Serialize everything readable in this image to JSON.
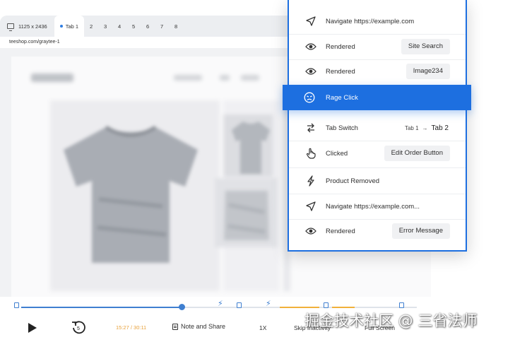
{
  "tabbar": {
    "dimensions": "1125 x 2436",
    "tabs": [
      "Tab 1",
      "2",
      "3",
      "4",
      "5",
      "6",
      "7",
      "8"
    ]
  },
  "url": "teeshop.com/graytee-1",
  "controls": {
    "time": "15:27 / 30:11",
    "note_label": "Note and Share",
    "speed_label": "1X",
    "skip_label": "Skip Inactivity",
    "fullscreen_label": "Full Screen"
  },
  "events": {
    "navigate1": "Navigate https://example.com",
    "rendered1": {
      "label": "Rendered",
      "target": "Site Search"
    },
    "rendered2": {
      "label": "Rendered",
      "target": "Image234"
    },
    "rage": "Rage Click",
    "tab_switch": {
      "label": "Tab Switch",
      "from": "Tab 1",
      "to": "Tab 2"
    },
    "clicked": {
      "label": "Clicked",
      "target": "Edit Order Button"
    },
    "product_removed": "Product Removed",
    "navigate2": "Navigate https://example.com...",
    "rendered3": {
      "label": "Rendered",
      "target": "Error Message"
    }
  },
  "watermark": "掘金技术社区 @ 三省法师",
  "colors": {
    "accent": "#1d6fe0",
    "timeline_played": "#3f7fd0",
    "timeline_activity": "#f1b13a",
    "time_text": "#e8a13a"
  },
  "icons": {
    "navigate": "navigation-arrow-icon",
    "rendered": "eye-icon",
    "rage": "angry-face-icon",
    "tab_switch": "swap-arrows-icon",
    "clicked": "pointer-hand-icon",
    "product_removed": "lightning-bolt-icon"
  }
}
